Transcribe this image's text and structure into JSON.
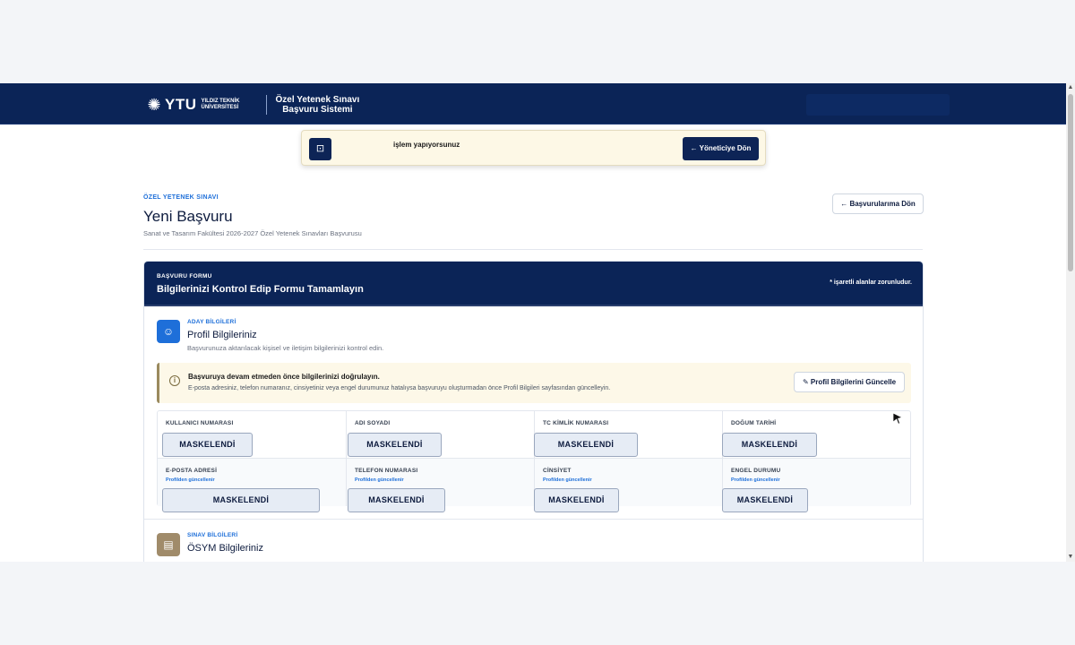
{
  "header": {
    "logo_short": "YTU",
    "logo_university": "YILDIZ TEKNİK ÜNİVERSİTESİ",
    "system_line1": "Özel Yetenek Sınavı",
    "system_line2": "Başvuru Sistemi"
  },
  "banner": {
    "text": "işlem yapıyorsunuz",
    "button_label": "Yöneticiye Dön"
  },
  "page": {
    "eyebrow": "ÖZEL YETENEK SINAVI",
    "title": "Yeni Başvuru",
    "subtitle": "Sanat ve Tasarım Fakültesi 2026-2027 Özel Yetenek Sınavları Başvurusu",
    "back_button": "Başvurularıma Dön"
  },
  "form": {
    "eyebrow": "BAŞVURU FORMU",
    "title": "Bilgilerinizi Kontrol Edip Formu Tamamlayın",
    "required_note": "işaretli alanlar zorunludur."
  },
  "candidate_section": {
    "eyebrow": "ADAY BİLGİLERİ",
    "title": "Profil Bilgileriniz",
    "description": "Başvurunuza aktarılacak kişisel ve iletişim bilgilerinizi kontrol edin.",
    "warning_title": "Başvuruya devam etmeden önce bilgilerinizi doğrulayın.",
    "warning_text": "E-posta adresiniz, telefon numaranız, cinsiyetiniz veya engel durumunuz hatalıysa başvuruyu oluşturmadan önce Profil Bilgileri sayfasından güncelleyin.",
    "update_button": "Profil Bilgilerini Güncelle",
    "fields": [
      {
        "label": "KULLANICI NUMARASI",
        "hint": "",
        "value": "MASKELENDİ"
      },
      {
        "label": "ADI SOYADI",
        "hint": "",
        "value": "MASKELENDİ"
      },
      {
        "label": "TC KİMLİK NUMARASI",
        "hint": "",
        "value": "MASKELENDİ"
      },
      {
        "label": "DOĞUM TARİHİ",
        "hint": "",
        "value": "MASKELENDİ"
      },
      {
        "label": "E-POSTA ADRESİ",
        "hint": "Profilden güncellenir",
        "value": "MASKELENDİ"
      },
      {
        "label": "TELEFON NUMARASI",
        "hint": "Profilden güncellenir",
        "value": "MASKELENDİ"
      },
      {
        "label": "CİNSİYET",
        "hint": "Profilden güncellenir",
        "value": "MASKELENDİ"
      },
      {
        "label": "ENGEL DURUMU",
        "hint": "Profilden güncellenir",
        "value": "MASKELENDİ"
      }
    ]
  },
  "exam_section": {
    "eyebrow": "SINAV BİLGİLERİ",
    "title": "ÖSYM Bilgileriniz"
  },
  "colors": {
    "navy": "#0b2457",
    "accent_blue": "#1e6fd9",
    "exam_icon": "#a08b6a"
  }
}
